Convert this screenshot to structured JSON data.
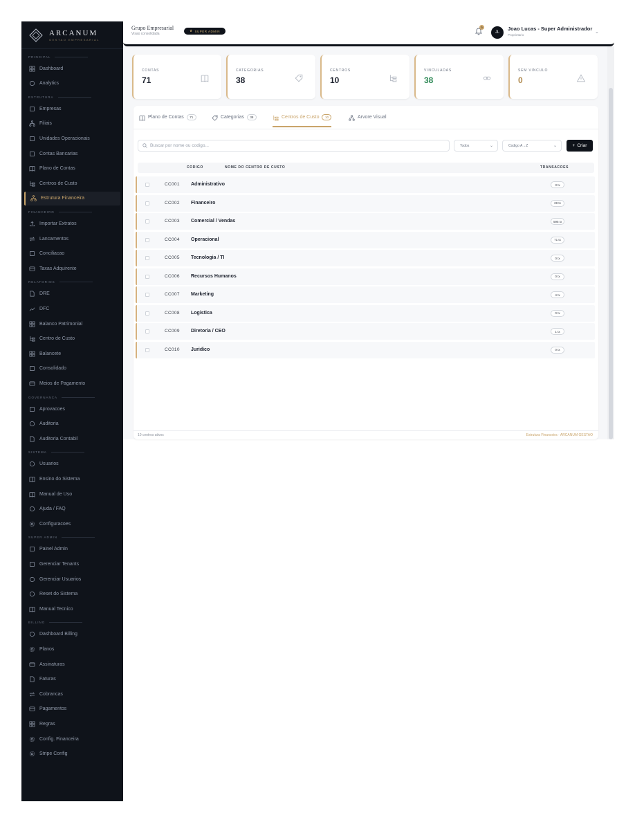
{
  "brand": {
    "name": "ARCANUM",
    "tagline": "GESTAO EMPRESARIAL"
  },
  "header": {
    "group_title": "Grupo Empresarial",
    "group_subtitle": "Visao consolidada",
    "badge": "SUPER ADMIN",
    "notification_count": "3",
    "avatar_initials": "JL",
    "user_name": "Joao Lucas - Super Administrador",
    "user_role": "Proprietario"
  },
  "sidebar": {
    "sections": [
      {
        "label": "PRINCIPAL",
        "items": [
          "Dashboard",
          "Analytics"
        ]
      },
      {
        "label": "ESTRUTURA",
        "items": [
          "Empresas",
          "Filiais",
          "Unidades Operacionais",
          "Contas Bancarias",
          "Plano de Contas",
          "Centros de Custo",
          "Estrutura Financeira"
        ]
      },
      {
        "label": "FINANCEIRO",
        "items": [
          "Importar Extratos",
          "Lancamentos",
          "Conciliacao",
          "Taxas Adquirente"
        ]
      },
      {
        "label": "RELATORIOS",
        "items": [
          "DRE",
          "DFC",
          "Balanco Patrimonial",
          "Centro de Custo",
          "Balancete",
          "Consolidado",
          "Meios de Pagamento"
        ]
      },
      {
        "label": "GOVERNANCA",
        "items": [
          "Aprovacoes",
          "Auditoria",
          "Auditoria Contabil"
        ]
      },
      {
        "label": "SISTEMA",
        "items": [
          "Usuarios",
          "Ensino do Sistema",
          "Manual de Uso",
          "Ajuda / FAQ",
          "Configuracoes"
        ]
      },
      {
        "label": "SUPER ADMIN",
        "items": [
          "Painel Admin",
          "Gerenciar Tenants",
          "Gerenciar Usuarios",
          "Reset do Sistema",
          "Manual Tecnico"
        ]
      },
      {
        "label": "BILLING",
        "items": [
          "Dashboard Billing",
          "Planos",
          "Assinaturas",
          "Faturas",
          "Cobrancas",
          "Pagamentos",
          "Regras",
          "Config. Financeira",
          "Stripe Config"
        ]
      }
    ],
    "active_item": "Estrutura Financeira"
  },
  "stats": [
    {
      "label": "CONTAS",
      "value": "71",
      "icon": "book-icon",
      "tone": "default"
    },
    {
      "label": "CATEGORIAS",
      "value": "38",
      "icon": "tag-icon",
      "tone": "default"
    },
    {
      "label": "CENTROS",
      "value": "10",
      "icon": "hierarchy-icon",
      "tone": "default"
    },
    {
      "label": "VINCULADAS",
      "value": "38",
      "icon": "link-icon",
      "tone": "green"
    },
    {
      "label": "SEM VINCULO",
      "value": "0",
      "icon": "warning-icon",
      "tone": "gold"
    }
  ],
  "tabs": [
    {
      "label": "Plano de Contas",
      "count": "71",
      "icon": "book-icon"
    },
    {
      "label": "Categorias",
      "count": "38",
      "icon": "tag-icon"
    },
    {
      "label": "Centros de Custo",
      "count": "10",
      "icon": "hierarchy-icon",
      "active": true
    },
    {
      "label": "Arvore Visual",
      "count": "",
      "icon": "tree-icon"
    }
  ],
  "toolbar": {
    "search_placeholder": "Buscar por nome ou codigo...",
    "filter_value": "Todos",
    "sort_value": "Codigo A→Z",
    "create_label": "Criar"
  },
  "table": {
    "headers": {
      "code": "CODIGO",
      "name": "NOME DO CENTRO DE CUSTO",
      "tx": "TRANSACOES"
    },
    "rows": [
      {
        "code": "CC001",
        "name": "Administrativo",
        "tx": "3 tx"
      },
      {
        "code": "CC002",
        "name": "Financeiro",
        "tx": "28 tx"
      },
      {
        "code": "CC003",
        "name": "Comercial / Vendas",
        "tx": "595 tx"
      },
      {
        "code": "CC004",
        "name": "Operacional",
        "tx": "71 tx"
      },
      {
        "code": "CC005",
        "name": "Tecnologia / TI",
        "tx": "0 tx"
      },
      {
        "code": "CC006",
        "name": "Recursos Humanos",
        "tx": "0 tx"
      },
      {
        "code": "CC007",
        "name": "Marketing",
        "tx": "4 tx"
      },
      {
        "code": "CC008",
        "name": "Logistica",
        "tx": "0 tx"
      },
      {
        "code": "CC009",
        "name": "Diretoria / CEO",
        "tx": "1 tx"
      },
      {
        "code": "CC010",
        "name": "Juridico",
        "tx": "0 tx"
      }
    ]
  },
  "footer": {
    "left": "10 centros ativos",
    "right": "Estrutura Financeira · ARCANUM GESTAO"
  },
  "colors": {
    "accent": "#c9a46a",
    "sidebar_bg": "#0f131a",
    "positive": "#2f8a57"
  }
}
